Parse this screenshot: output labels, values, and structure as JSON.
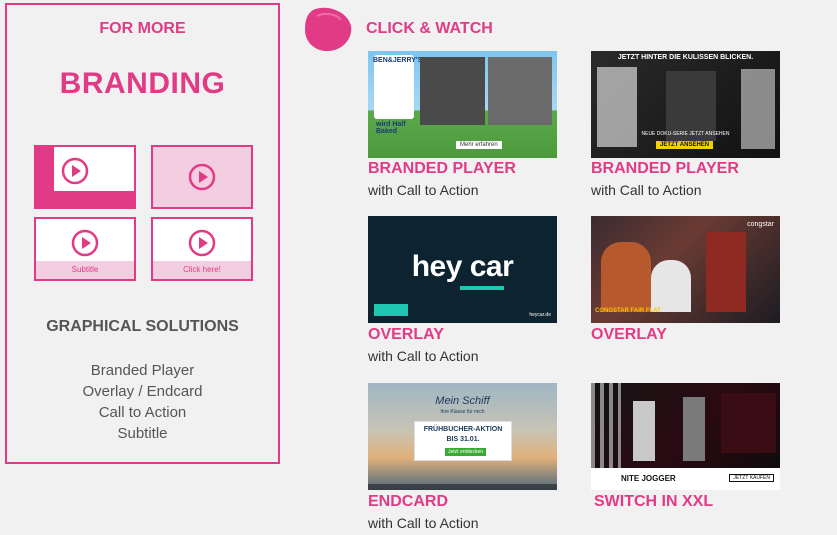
{
  "left_panel": {
    "for_more": "FOR MORE",
    "branding": "BRANDING",
    "tiles": {
      "subtitle_caption": "Subtitle",
      "click_caption": "Click here!"
    },
    "graphical_title": "GRAPHICAL SOLUTIONS",
    "features": [
      "Branded Player",
      "Overlay / Endcard",
      "Call to Action",
      "Subtitle"
    ]
  },
  "right_panel": {
    "header": "CLICK & WATCH",
    "videos": [
      {
        "title": "BRANDED PLAYER",
        "subtitle": "with Call to Action",
        "thumb_texts": {
          "brand": "BEN&JERRY'S",
          "cta": "Mehr erfahren",
          "tagline": "wird Half Baked"
        }
      },
      {
        "title": "BRANDED PLAYER",
        "subtitle": "with Call to Action",
        "thumb_texts": {
          "headline": "JETZT HINTER DIE KULISSEN BLICKEN.",
          "small": "NEUE DOKU-SERIE JETZT ANSEHEN",
          "cta": "JETZT ANSEHEN"
        }
      },
      {
        "title": "OVERLAY",
        "subtitle": "with Call to Action",
        "thumb_texts": {
          "logo": "hey car",
          "site": "heycar.de"
        }
      },
      {
        "title": "OVERLAY",
        "subtitle": "",
        "thumb_texts": {
          "brand": "congstar",
          "tag": "CONGSTAR FAIR FLAT"
        }
      },
      {
        "title": "ENDCARD",
        "subtitle": "with Call to Action",
        "thumb_texts": {
          "brand": "Mein Schiff",
          "sub": "Ihre Klasse für mich",
          "headline": "FRÜHBUCHER-AKTION",
          "date": "BIS 31.01.",
          "cta": "Jetzt entdecken"
        }
      },
      {
        "title": "SWITCH IN XXL",
        "subtitle": "",
        "thumb_texts": {
          "product": "NITE JOGGER",
          "cta": "JETZT KAUFEN"
        }
      }
    ]
  },
  "colors": {
    "accent": "#e23b86",
    "accent_light": "#f3cde0",
    "text_gray": "#555555",
    "background": "#f1f1f1"
  }
}
